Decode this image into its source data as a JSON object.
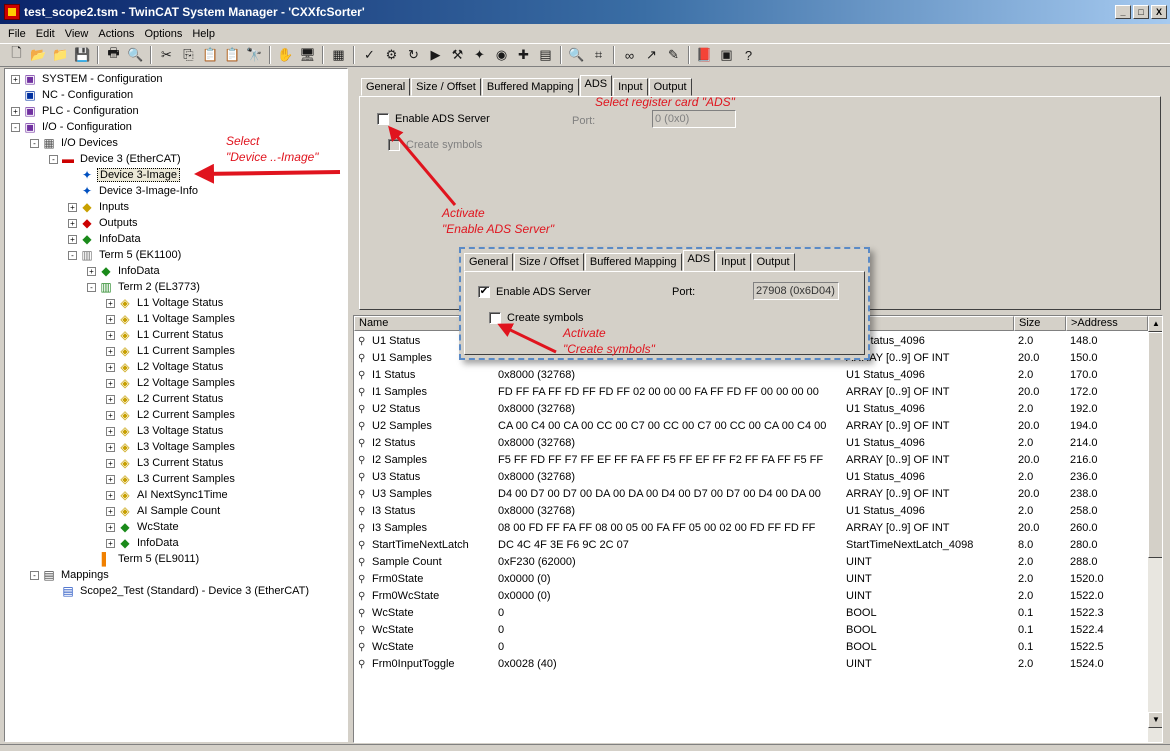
{
  "window": {
    "title": "test_scope2.tsm - TwinCAT System Manager - 'CXXfcSorter'",
    "minimize_glyph": "_",
    "maximize_glyph": "□",
    "close_glyph": "X"
  },
  "menu": [
    "File",
    "Edit",
    "View",
    "Actions",
    "Options",
    "Help"
  ],
  "toolbar_icons": [
    "new-icon",
    "open-icon",
    "open-folder-icon",
    "save-icon",
    "print-icon",
    "print-preview-icon",
    "cut-icon",
    "copy-icon",
    "paste-icon",
    "paste-with-links-icon",
    "find-icon",
    "goto-icon",
    "target-system-icon",
    "generate-mappings-icon",
    "check-icon",
    "activate-icon",
    "restart-icon",
    "run-mode-icon",
    "config-mode-icon",
    "scan-icon",
    "toggle-icon",
    "freerun-icon",
    "show-icon",
    "zoom-icon",
    "monitor-icon",
    "online-icon",
    "force-icon",
    "write-icon",
    "book-icon",
    "help-file-icon",
    "help-icon"
  ],
  "tree": [
    {
      "label": "SYSTEM - Configuration",
      "exp": "+",
      "icon": "system-icon"
    },
    {
      "label": "NC - Configuration",
      "exp": "",
      "icon": "nc-icon"
    },
    {
      "label": "PLC - Configuration",
      "exp": "+",
      "icon": "plc-icon"
    },
    {
      "label": "I/O - Configuration",
      "exp": "-",
      "icon": "io-icon"
    },
    {
      "label": "I/O Devices",
      "exp": "-",
      "icon": "io-devices-icon"
    },
    {
      "label": "Device 3 (EtherCAT)",
      "exp": "-",
      "icon": "ethercat-device-icon"
    },
    {
      "label": "Device 3-Image",
      "exp": "",
      "icon": "image-icon"
    },
    {
      "label": "Device 3-Image-Info",
      "exp": "",
      "icon": "image-info-icon"
    },
    {
      "label": "Inputs",
      "exp": "+",
      "icon": "inputs-icon"
    },
    {
      "label": "Outputs",
      "exp": "+",
      "icon": "outputs-icon"
    },
    {
      "label": "InfoData",
      "exp": "+",
      "icon": "infodata-icon"
    },
    {
      "label": "Term 5 (EK1100)",
      "exp": "-",
      "icon": "coupler-icon"
    },
    {
      "label": "InfoData",
      "exp": "+",
      "icon": "infodata-icon"
    },
    {
      "label": "Term 2 (EL3773)",
      "exp": "-",
      "icon": "terminal-icon"
    },
    {
      "label": "L1 Voltage Status",
      "exp": "+",
      "icon": "input-var-icon"
    },
    {
      "label": "L1 Voltage Samples",
      "exp": "+",
      "icon": "input-var-icon"
    },
    {
      "label": "L1 Current Status",
      "exp": "+",
      "icon": "input-var-icon"
    },
    {
      "label": "L1 Current Samples",
      "exp": "+",
      "icon": "input-var-icon"
    },
    {
      "label": "L2 Voltage Status",
      "exp": "+",
      "icon": "input-var-icon"
    },
    {
      "label": "L2 Voltage Samples",
      "exp": "+",
      "icon": "input-var-icon"
    },
    {
      "label": "L2 Current Status",
      "exp": "+",
      "icon": "input-var-icon"
    },
    {
      "label": "L2 Current Samples",
      "exp": "+",
      "icon": "input-var-icon"
    },
    {
      "label": "L3 Voltage Status",
      "exp": "+",
      "icon": "input-var-icon"
    },
    {
      "label": "L3 Voltage Samples",
      "exp": "+",
      "icon": "input-var-icon"
    },
    {
      "label": "L3 Current Status",
      "exp": "+",
      "icon": "input-var-icon"
    },
    {
      "label": "L3 Current Samples",
      "exp": "+",
      "icon": "input-var-icon"
    },
    {
      "label": "AI NextSync1Time",
      "exp": "+",
      "icon": "input-var-icon"
    },
    {
      "label": "AI Sample Count",
      "exp": "+",
      "icon": "input-var-icon"
    },
    {
      "label": "WcState",
      "exp": "+",
      "icon": "infodata-icon"
    },
    {
      "label": "InfoData",
      "exp": "+",
      "icon": "infodata-icon"
    },
    {
      "label": "Term 5 (EL9011)",
      "exp": "",
      "icon": "end-terminal-icon"
    },
    {
      "label": "Mappings",
      "exp": "-",
      "icon": "mappings-icon"
    },
    {
      "label": "Scope2_Test (Standard) - Device 3 (EtherCAT)",
      "exp": "",
      "icon": "mapping-icon"
    }
  ],
  "tabs": [
    "General",
    "Size / Offset",
    "Buffered Mapping",
    "ADS",
    "Input",
    "Output"
  ],
  "ads_panel": {
    "enable_label": "Enable ADS Server",
    "enable_checked": false,
    "port_label": "Port:",
    "port_value": "0 (0x0)",
    "create_label": "Create symbols"
  },
  "popup": {
    "enable_label": "Enable ADS Server",
    "enable_checked": true,
    "port_label": "Port:",
    "port_value": "27908 (0x6D04)",
    "create_label": "Create symbols",
    "create_checked": false
  },
  "grid": {
    "columns": [
      "Name",
      "",
      "",
      "Size",
      ">Address"
    ],
    "rows": [
      [
        "U1 Status",
        "",
        "U1 Status_4096",
        "2.0",
        "148.0"
      ],
      [
        "U1 Samples",
        "",
        "ARRAY [0..9] OF INT",
        "20.0",
        "150.0"
      ],
      [
        "I1 Status",
        "0x8000 (32768)",
        "U1 Status_4096",
        "2.0",
        "170.0"
      ],
      [
        "I1 Samples",
        "FD FF FA FF FD FF FD FF 02 00 00 00 FA FF FD FF 00 00 00 00",
        "ARRAY [0..9] OF INT",
        "20.0",
        "172.0"
      ],
      [
        "U2 Status",
        "0x8000 (32768)",
        "U1 Status_4096",
        "2.0",
        "192.0"
      ],
      [
        "U2 Samples",
        "CA 00 C4 00 CA 00 CC 00 C7 00 CC 00 C7 00 CC 00 CA 00 C4 00",
        "ARRAY [0..9] OF INT",
        "20.0",
        "194.0"
      ],
      [
        "I2 Status",
        "0x8000 (32768)",
        "U1 Status_4096",
        "2.0",
        "214.0"
      ],
      [
        "I2 Samples",
        "F5 FF FD FF F7 FF EF FF FA FF F5 FF EF FF F2 FF FA FF F5 FF",
        "ARRAY [0..9] OF INT",
        "20.0",
        "216.0"
      ],
      [
        "U3 Status",
        "0x8000 (32768)",
        "U1 Status_4096",
        "2.0",
        "236.0"
      ],
      [
        "U3 Samples",
        "D4 00 D7 00 D7 00 DA 00 DA 00 D4 00 D7 00 D7 00 D4 00 DA 00",
        "ARRAY [0..9] OF INT",
        "20.0",
        "238.0"
      ],
      [
        "I3 Status",
        "0x8000 (32768)",
        "U1 Status_4096",
        "2.0",
        "258.0"
      ],
      [
        "I3 Samples",
        "08 00 FD FF FA FF 08 00 05 00 FA FF 05 00 02 00 FD FF FD FF",
        "ARRAY [0..9] OF INT",
        "20.0",
        "260.0"
      ],
      [
        "StartTimeNextLatch",
        "DC 4C 4F 3E F6 9C 2C 07",
        "StartTimeNextLatch_4098",
        "8.0",
        "280.0"
      ],
      [
        "Sample Count",
        "0xF230 (62000)",
        "UINT",
        "2.0",
        "288.0"
      ],
      [
        "Frm0State",
        "0x0000 (0)",
        "UINT",
        "2.0",
        "1520.0"
      ],
      [
        "Frm0WcState",
        "0x0000 (0)",
        "UINT",
        "2.0",
        "1522.0"
      ],
      [
        "WcState",
        "0",
        "BOOL",
        "0.1",
        "1522.3"
      ],
      [
        "WcState",
        "0",
        "BOOL",
        "0.1",
        "1522.4"
      ],
      [
        "WcState",
        "0",
        "BOOL",
        "0.1",
        "1522.5"
      ],
      [
        "Frm0InputToggle",
        "0x0028 (40)",
        "UINT",
        "2.0",
        "1524.0"
      ]
    ]
  },
  "annotations": {
    "select_image_1": "Select",
    "select_image_2": "\"Device ..-Image\"",
    "select_card": "Select register card \"ADS\"",
    "activate_ads_1": "Activate",
    "activate_ads_2": "\"Enable ADS Server\"",
    "activate_sym_1": "Activate",
    "activate_sym_2": "\"Create symbols\""
  },
  "colors": {
    "annotation": "#e0141e",
    "popup_border": "#5a8ac6",
    "title_gradient_start": "#0a246a"
  }
}
